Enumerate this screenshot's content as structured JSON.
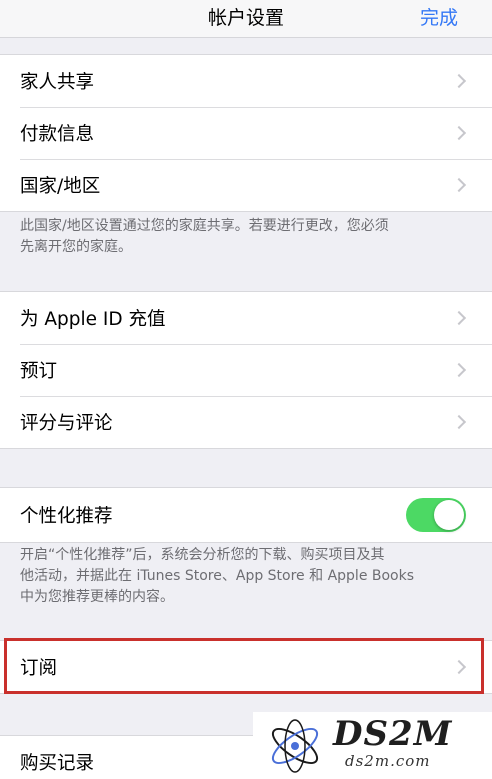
{
  "navbar": {
    "title": "帐户设置",
    "done_label": "完成"
  },
  "group1": {
    "items": [
      "家人共享",
      "付款信息",
      "国家/地区"
    ]
  },
  "note1": {
    "line1": "此国家/地区设置通过您的家庭共享。若要进行更改，您必须",
    "line2": "先离开您的家庭。"
  },
  "group2": {
    "items": [
      "为 Apple ID 充值",
      "预订",
      "评分与评论"
    ]
  },
  "personalization": {
    "label": "个性化推荐",
    "toggle_on": true
  },
  "note2": {
    "line1": "开启“个性化推荐”后，系统会分析您的下载、购买项目及其",
    "line2": "他活动，并据此在 iTunes Store、App Store 和 Apple Books",
    "line3": "中为您推荐更棒的内容。"
  },
  "subscriptions": {
    "label": "订阅"
  },
  "purchase_history": {
    "label": "购买记录"
  },
  "watermark": {
    "text": "DS2M",
    "domain": "ds2m.com"
  },
  "colors": {
    "accent": "#3478f6",
    "toggle_on": "#4cd964",
    "highlight": "#c9302c"
  }
}
